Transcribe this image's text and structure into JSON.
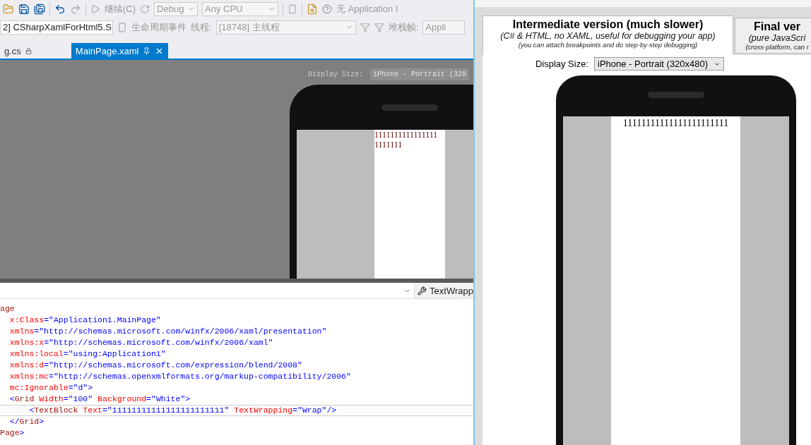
{
  "toolbar": {
    "continue_label": "继续(C)",
    "configuration": "Debug",
    "platform": "Any CPU",
    "application_text": "无 Application I"
  },
  "debug_bar": {
    "process": "2] CSharpXamlForHtml5.S",
    "lifecycle_label": "生命周期事件",
    "thread_label": "线程:",
    "thread": "[18748] 主线程",
    "stack_label": "堆栈帧:",
    "stack_frame": "Appli"
  },
  "tabs": [
    {
      "label": "g.cs",
      "selected": false,
      "locked": true
    },
    {
      "label": "MainPage.xaml",
      "selected": true,
      "locked": false
    }
  ],
  "designer": {
    "display_size_label": "Display Size:",
    "display_size": "iPhone - Portrait (320",
    "preview_lines": [
      "1111111111111111",
      "1111111"
    ]
  },
  "editor": {
    "property_button": "TextWrapp",
    "lines": [
      {
        "current": false,
        "tokens": [
          {
            "kind": "tag",
            "text": "age"
          }
        ]
      },
      {
        "current": false,
        "tokens": [
          {
            "kind": "attr",
            "text": "  x:Class"
          },
          {
            "kind": "punct",
            "text": "="
          },
          {
            "kind": "value",
            "text": "\"Application1.MainPage\""
          }
        ]
      },
      {
        "current": false,
        "tokens": [
          {
            "kind": "attr",
            "text": "  xmlns"
          },
          {
            "kind": "punct",
            "text": "="
          },
          {
            "kind": "value",
            "text": "\"http://schemas.microsoft.com/winfx/2006/xaml/presentation\""
          }
        ]
      },
      {
        "current": false,
        "tokens": [
          {
            "kind": "attr",
            "text": "  xmlns:x"
          },
          {
            "kind": "punct",
            "text": "="
          },
          {
            "kind": "value",
            "text": "\"http://schemas.microsoft.com/winfx/2006/xaml\""
          }
        ]
      },
      {
        "current": false,
        "tokens": [
          {
            "kind": "attr",
            "text": "  xmlns:local"
          },
          {
            "kind": "punct",
            "text": "="
          },
          {
            "kind": "value",
            "text": "\"using:Application1\""
          }
        ]
      },
      {
        "current": false,
        "tokens": [
          {
            "kind": "attr",
            "text": "  xmlns:d"
          },
          {
            "kind": "punct",
            "text": "="
          },
          {
            "kind": "value",
            "text": "\"http://schemas.microsoft.com/expression/blend/2008\""
          }
        ]
      },
      {
        "current": false,
        "tokens": [
          {
            "kind": "attr",
            "text": "  xmlns:mc"
          },
          {
            "kind": "punct",
            "text": "="
          },
          {
            "kind": "value",
            "text": "\"http://schemas.openxmlformats.org/markup-compatibility/2006\""
          }
        ]
      },
      {
        "current": false,
        "tokens": [
          {
            "kind": "attr",
            "text": "  mc:Ignorable"
          },
          {
            "kind": "punct",
            "text": "="
          },
          {
            "kind": "value",
            "text": "\"d\""
          },
          {
            "kind": "punct",
            "text": ">"
          }
        ]
      },
      {
        "current": false,
        "tokens": [
          {
            "kind": "punct",
            "text": "  <"
          },
          {
            "kind": "tag",
            "text": "Grid"
          },
          {
            "kind": "attr",
            "text": " Width"
          },
          {
            "kind": "punct",
            "text": "="
          },
          {
            "kind": "value",
            "text": "\"100\""
          },
          {
            "kind": "attr",
            "text": " Background"
          },
          {
            "kind": "punct",
            "text": "="
          },
          {
            "kind": "value",
            "text": "\"White\""
          },
          {
            "kind": "punct",
            "text": ">"
          }
        ]
      },
      {
        "current": true,
        "tokens": [
          {
            "kind": "punct",
            "text": "      <"
          },
          {
            "kind": "tag",
            "text": "TextBlock"
          },
          {
            "kind": "attr",
            "text": " Text"
          },
          {
            "kind": "punct",
            "text": "="
          },
          {
            "kind": "value",
            "text": "\"11111111111111111111111\""
          },
          {
            "kind": "attr",
            "text": " TextWrapping"
          },
          {
            "kind": "punct",
            "text": "="
          },
          {
            "kind": "value",
            "text": "\"Wrap\""
          },
          {
            "kind": "punct",
            "text": "/>"
          }
        ]
      },
      {
        "current": false,
        "tokens": [
          {
            "kind": "punct",
            "text": "  </"
          },
          {
            "kind": "tag",
            "text": "Grid"
          },
          {
            "kind": "punct",
            "text": ">"
          }
        ]
      },
      {
        "current": false,
        "tokens": [
          {
            "kind": "tag",
            "text": "Page"
          },
          {
            "kind": "punct",
            "text": ">"
          }
        ]
      }
    ]
  },
  "simulator": {
    "tabs": [
      {
        "title": "Intermediate version (much slower)",
        "subtitle": "(C# & HTML, no XAML, useful for debugging your app)",
        "note": "(you can attach breakpoints and do step-by-step debugging)",
        "selected": true
      },
      {
        "title": "Final ver",
        "subtitle": "(pure JavaScri",
        "note": "(cross-platform, can r",
        "selected": false
      }
    ],
    "display_size_label": "Display Size:",
    "display_size": "iPhone - Portrait (320x480)",
    "preview_text": "11111111111111111111111"
  }
}
